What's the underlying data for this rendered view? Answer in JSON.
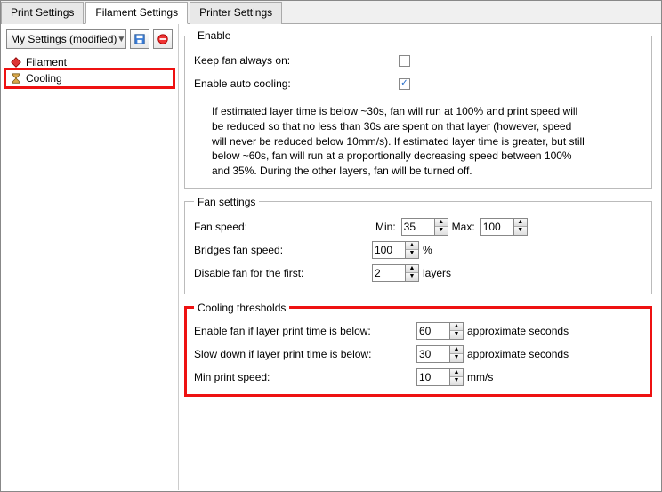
{
  "tabs": {
    "print": "Print Settings",
    "filament": "Filament Settings",
    "printer": "Printer Settings"
  },
  "preset": {
    "name": "My Settings (modified)"
  },
  "sidebar": {
    "filament": "Filament",
    "cooling": "Cooling"
  },
  "enable": {
    "legend": "Enable",
    "keep_always": "Keep fan always on:",
    "auto_cooling": "Enable auto cooling:",
    "info": "If estimated layer time is below ~30s, fan will run at 100% and print speed will be reduced so that no less than 30s are spent on that layer (however, speed will never be reduced below 10mm/s). If estimated layer time is greater, but still below ~60s, fan will run at a proportionally decreasing speed between 100% and 35%. During the other layers, fan will be turned off."
  },
  "fan": {
    "legend": "Fan settings",
    "speed_label": "Fan speed:",
    "min_label": "Min:",
    "min_value": "35",
    "max_label": "Max:",
    "max_value": "100",
    "bridges_label": "Bridges fan speed:",
    "bridges_value": "100",
    "percent": "%",
    "disable_label": "Disable fan for the first:",
    "disable_value": "2",
    "layers": "layers"
  },
  "thresh": {
    "legend": "Cooling thresholds",
    "enable_label": "Enable fan if layer print time is below:",
    "enable_value": "60",
    "approx": "approximate seconds",
    "slow_label": "Slow down if layer print time is below:",
    "slow_value": "30",
    "min_label": "Min print speed:",
    "min_value": "10",
    "mms": "mm/s"
  }
}
